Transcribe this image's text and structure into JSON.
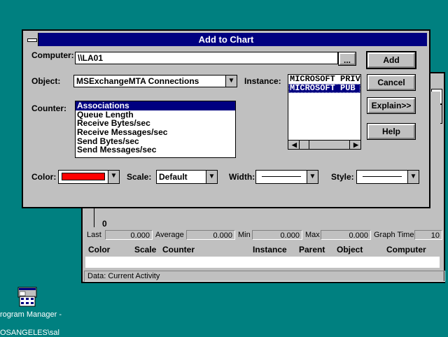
{
  "background_window": {
    "zero_label": "0",
    "stats": {
      "last_label": "Last",
      "last_value": "0.000",
      "average_label": "Average",
      "average_value": "0.000",
      "min_label": "Min",
      "min_value": "0.000",
      "max_label": "Max",
      "max_value": "0.000",
      "graph_time_label": "Graph Time",
      "graph_time_value": "10"
    },
    "legend_headers": [
      "Color",
      "Scale",
      "Counter",
      "Instance",
      "Parent",
      "Object",
      "Computer"
    ],
    "status": "Data: Current Activity"
  },
  "dialog": {
    "title": "Add to Chart",
    "computer_label": "Computer:",
    "computer_value": "\\\\LA01",
    "browse_label": "...",
    "object_label": "Object:",
    "object_value": "MSExchangeMTA Connections",
    "instance_label": "Instance:",
    "instances": [
      "MICROSOFT PRIV",
      "MICROSOFT PUB"
    ],
    "counter_label": "Counter:",
    "counters": [
      "Associations",
      "Queue Length",
      "Receive Bytes/sec",
      "Receive Messages/sec",
      "Send Bytes/sec",
      "Send Messages/sec"
    ],
    "color_label": "Color:",
    "color_value": "#ff0000",
    "scale_label": "Scale:",
    "scale_value": "Default",
    "width_label": "Width:",
    "style_label": "Style:",
    "buttons": {
      "add": "Add",
      "cancel": "Cancel",
      "explain": "Explain>>",
      "help": "Help"
    }
  },
  "desktop": {
    "icon_label": "rogram Manager -",
    "icon_sublabel": "OSANGELES\\sal"
  }
}
